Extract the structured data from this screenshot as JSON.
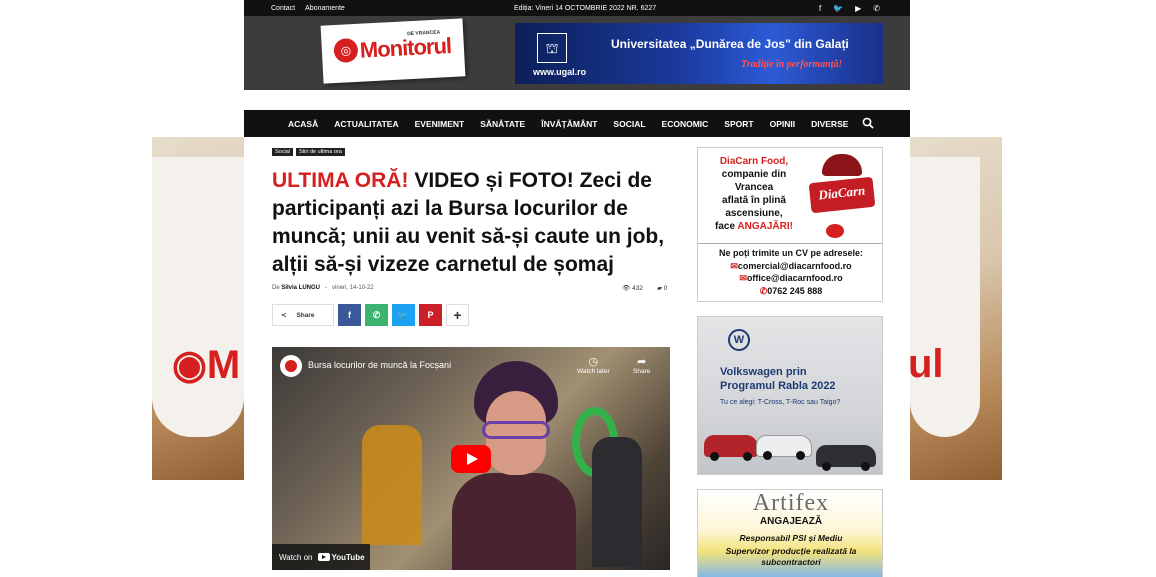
{
  "topbar": {
    "links": [
      "Contact",
      "Abonamente"
    ],
    "edition": "Ediția: Vineri 14 OCTOMBRIE 2022 NR. 6227",
    "social": [
      {
        "icon": "facebook-icon",
        "glyph": "f"
      },
      {
        "icon": "twitter-icon",
        "glyph": "🐦"
      },
      {
        "icon": "youtube-icon",
        "glyph": "▶"
      },
      {
        "icon": "whatsapp-icon",
        "glyph": "✆"
      }
    ]
  },
  "header": {
    "logo_text": "Monitorul",
    "logo_sub": "DE VRANCEA",
    "ad": {
      "title": "Universitatea „Dunărea de Jos\" din Galați",
      "slogan": "Tradiție în performanță!",
      "url": "www.ugal.ro"
    }
  },
  "nav": {
    "items": [
      "ACASĂ",
      "ACTUALITATEA",
      "EVENIMENT",
      "SĂNĂTATE",
      "ÎNVĂȚĂMÂNT",
      "SOCIAL",
      "ECONOMIC",
      "SPORT",
      "OPINII",
      "DIVERSE"
    ]
  },
  "article": {
    "tags": [
      "Social",
      "Stiri de ultima ora"
    ],
    "headline_red": "ULTIMA ORĂ!",
    "headline_rest": " VIDEO și FOTO! Zeci de participanți azi la Bursa locurilor de muncă; unii au venit să-și caute un job, alții să-și vizeze carnetul de șomaj",
    "by": "De",
    "author": "Silvia LUNGU",
    "sep": "-",
    "date": "vineri, 14-10-22",
    "views": "432",
    "comments": "0",
    "share_label": "Share"
  },
  "video": {
    "title": "Bursa locurilor de muncă la Focșani",
    "watch_later": "Watch later",
    "share": "Share",
    "watch_on": "Watch on",
    "youtube": "YouTube"
  },
  "sidebar": {
    "ad1": {
      "lines": [
        "DiaCarn Food,",
        "companie din",
        "Vrancea",
        "aflată în plină",
        "ascensiune,"
      ],
      "face": "face ",
      "angajari": "ANGAJĂRI!",
      "logo": "DiaCarn",
      "contact_title": "Ne poți trimite un CV pe adresele:",
      "email1": "comercial@diacarnfood.ro",
      "email2": "office@diacarnfood.ro",
      "phone": "0762 245 888"
    },
    "ad2": {
      "line1": "Volkswagen prin",
      "line2": "Programul Rabla 2022",
      "line3": "Tu ce alegi: T-Cross, T-Roc sau Taigo?"
    },
    "ad3": {
      "brand": "Artifex",
      "line1": "ANGAJEAZĂ",
      "line2": "Responsabil PSI și Mediu",
      "line3": "Supervizor producție realizată la",
      "line4": "subcontractori"
    }
  },
  "colors": {
    "accent": "#d6201f",
    "facebook": "#3b5998",
    "whatsapp": "#3cb371",
    "twitter": "#1da1f2",
    "pinterest": "#cb2027",
    "more": "#ffffff"
  }
}
